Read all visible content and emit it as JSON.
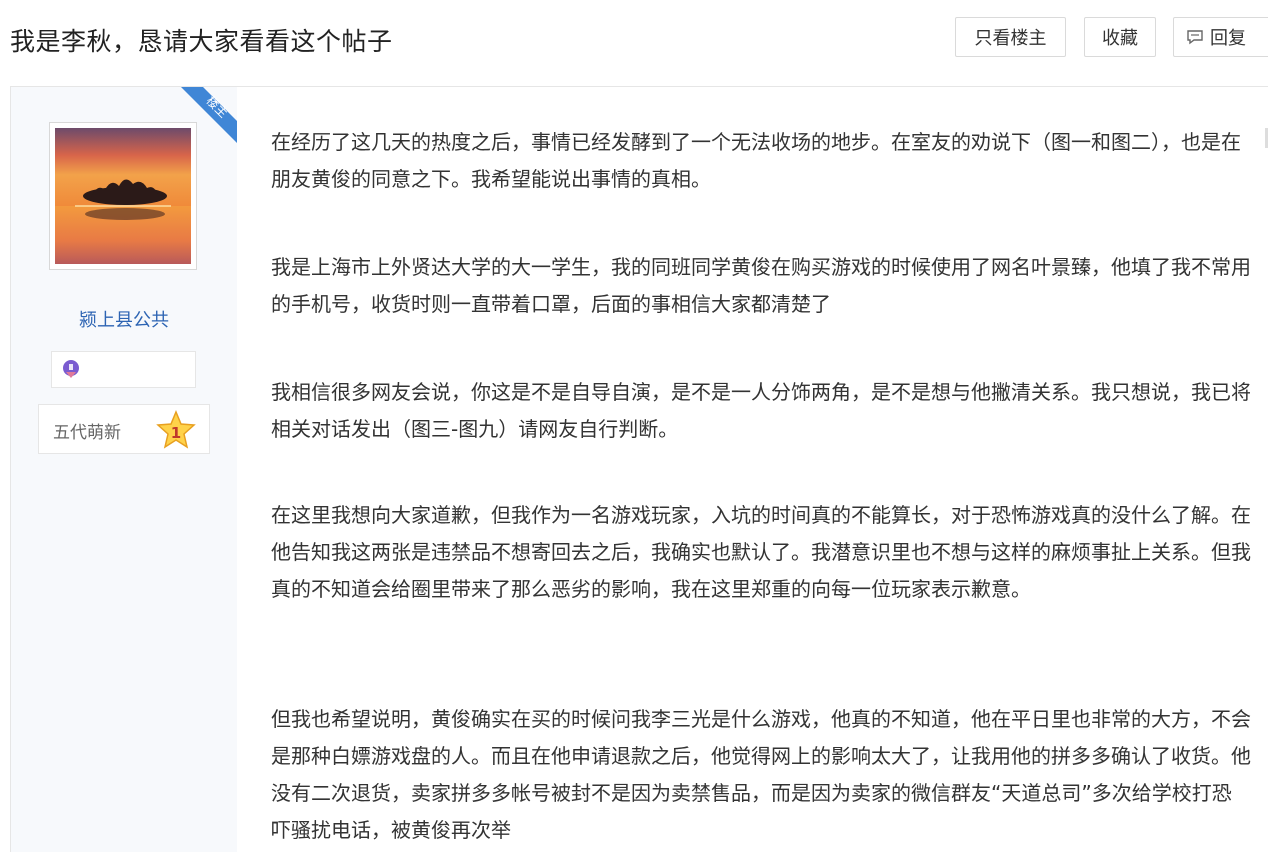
{
  "thread": {
    "title": "我是李秋，恳请大家看看这个帖子",
    "buttons": {
      "only_op": "只看楼主",
      "favorite": "收藏",
      "reply": "回复"
    }
  },
  "author": {
    "corner_badge": "楼主",
    "username": "颍上县公共",
    "level_title": "五代萌新",
    "level_number": "1",
    "avatar_icon": "sunset-lake-avatar",
    "badge_icon": "purple-badge-icon"
  },
  "post": {
    "paragraphs": [
      "在经历了这几天的热度之后，事情已经发酵到了一个无法收场的地步。在室友的劝说下（图一和图二），也是在朋友黄俊的同意之下。我希望能说出事情的真相。",
      "我是上海市上外贤达大学的大一学生，我的同班同学黄俊在购买游戏的时候使用了网名叶景臻，他填了我不常用的手机号，收货时则一直带着口罩，后面的事相信大家都清楚了",
      "我相信很多网友会说，你这是不是自导自演，是不是一人分饰两角，是不是想与他撇清关系。我只想说，我已将相关对话发出（图三-图九）请网友自行判断。",
      "在这里我想向大家道歉，但我作为一名游戏玩家，入坑的时间真的不能算长，对于恐怖游戏真的没什么了解。在他告知我这两张是违禁品不想寄回去之后，我确实也默认了。我潜意识里也不想与这样的麻烦事扯上关系。但我真的不知道会给圈里带来了那么恶劣的影响，我在这里郑重的向每一位玩家表示歉意。",
      "但我也希望说明，黄俊确实在买的时候问我李三光是什么游戏，他真的不知道，他在平日里也非常的大方，不会是那种白嫖游戏盘的人。而且在他申请退款之后，他觉得网上的影响太大了，让我用他的拼多多确认了收货。他没有二次退货，卖家拼多多帐号被封不是因为卖禁售品，而是因为卖家的微信群友“天道总司”多次给学校打恐吓骚扰电话，被黄俊再次举"
    ]
  },
  "colors": {
    "accent_blue": "#3f86d6",
    "username_blue": "#2d64b3",
    "sidebar_bg": "#f7f9fc"
  }
}
